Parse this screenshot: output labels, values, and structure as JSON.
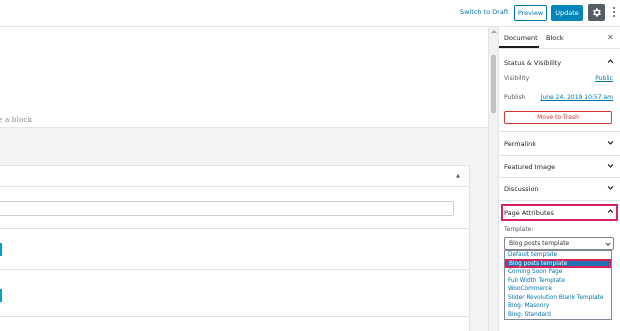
{
  "topbar": {
    "switch_to_draft": "Switch to Draft",
    "preview_label": "Preview",
    "update_label": "Update"
  },
  "editor": {
    "block_hint": "e a block"
  },
  "sidebar": {
    "tabs": [
      "Document",
      "Block"
    ],
    "active_tab": "Document",
    "status_visibility": {
      "title": "Status & Visibility",
      "visibility_label": "Visibility",
      "visibility_value": "Public",
      "publish_label": "Publish",
      "publish_value": "June 24, 2019 10:57 am",
      "trash_label": "Move to Trash"
    },
    "panels": [
      "Permalink",
      "Featured Image",
      "Discussion"
    ],
    "page_attributes": {
      "title": "Page Attributes",
      "template_label": "Template:",
      "selected": "Blog posts template",
      "options": [
        "Default template",
        "Blog posts template",
        "Coming Soon Page",
        "Full Width Template",
        "WooCommerce",
        "Slider Revolution Blank Template",
        "Blog: Masonry",
        "Blog: Standard"
      ]
    }
  },
  "colors": {
    "accent": "#0085ba",
    "link": "#0073aa",
    "highlight": "#d6235a",
    "danger": "#dc3232"
  },
  "icons": [
    "gear-icon",
    "more-icon",
    "close-icon",
    "chevron-up-icon",
    "chevron-down-icon"
  ]
}
